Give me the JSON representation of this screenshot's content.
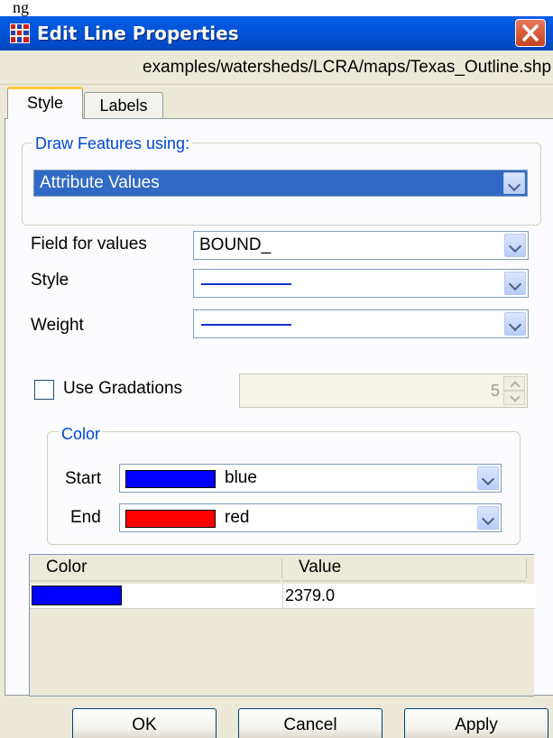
{
  "top_label": "ng",
  "window": {
    "title": "Edit Line Properties",
    "file_path": "examples/watersheds/LCRA/maps/Texas_Outline.shp"
  },
  "tabs": [
    {
      "label": "Style",
      "selected": true
    },
    {
      "label": "Labels",
      "selected": false
    }
  ],
  "draw_features": {
    "legend": "Draw Features using:",
    "selected": "Attribute Values"
  },
  "field_for_values": {
    "label": "Field for values",
    "value": "BOUND_"
  },
  "style": {
    "label": "Style"
  },
  "weight": {
    "label": "Weight"
  },
  "line_color": "#1133cc",
  "gradations": {
    "label": "Use Gradations",
    "checked": false,
    "value": "5"
  },
  "color_group": {
    "legend": "Color",
    "start": {
      "label": "Start",
      "name": "blue",
      "color": "#0000ff"
    },
    "end": {
      "label": "End",
      "name": "red",
      "color": "#ff0000"
    }
  },
  "table": {
    "headers": [
      "Color",
      "Value"
    ],
    "rows": [
      {
        "color": "#0000ff",
        "value": "2379.0"
      }
    ]
  },
  "buttons": {
    "ok": "OK",
    "cancel": "Cancel",
    "apply": "Apply"
  },
  "colors": {
    "titlebar": "#0058e0",
    "selection": "#316ac5",
    "legend_text": "#0046d5",
    "tab_highlight": "#ffc83c",
    "close_button": "#c6441f"
  }
}
